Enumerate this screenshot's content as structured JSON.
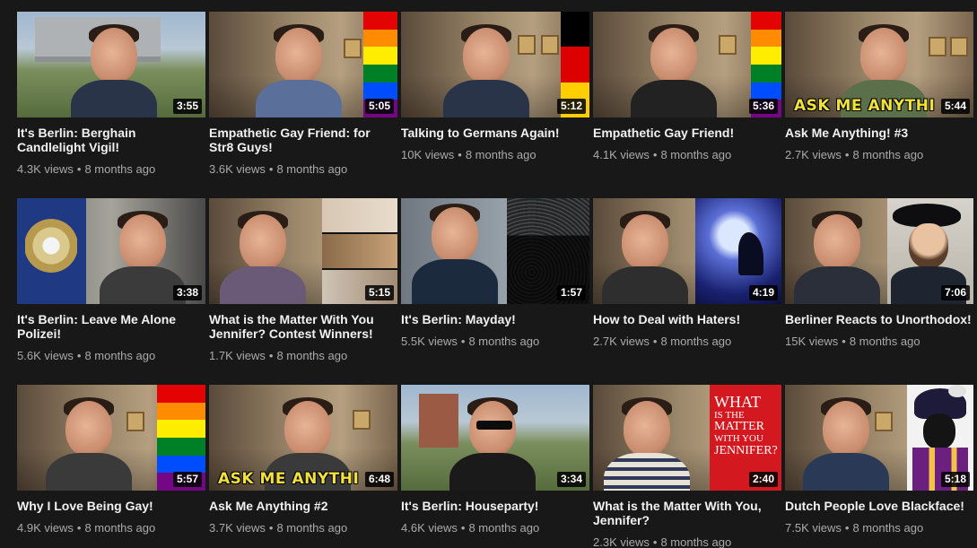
{
  "videos": [
    {
      "title": "It's Berlin: Berghain Candlelight Vigil!",
      "duration": "3:55",
      "views": "4.3K views",
      "age": "8 months ago"
    },
    {
      "title": "Empathetic Gay Friend: for Str8 Guys!",
      "duration": "5:05",
      "views": "3.6K views",
      "age": "8 months ago"
    },
    {
      "title": "Talking to Germans Again!",
      "duration": "5:12",
      "views": "10K views",
      "age": "8 months ago"
    },
    {
      "title": "Empathetic Gay Friend!",
      "duration": "5:36",
      "views": "4.1K views",
      "age": "8 months ago"
    },
    {
      "title": "Ask Me Anything! #3",
      "duration": "5:44",
      "views": "2.7K views",
      "age": "8 months ago",
      "overlay": "ASK ME ANYTHI"
    },
    {
      "title": "It's Berlin: Leave Me Alone Polizei!",
      "duration": "3:38",
      "views": "5.6K views",
      "age": "8 months ago"
    },
    {
      "title": "What is the Matter With You Jennifer? Contest Winners!",
      "duration": "5:15",
      "views": "1.7K views",
      "age": "8 months ago"
    },
    {
      "title": "It's Berlin: Mayday!",
      "duration": "1:57",
      "views": "5.5K views",
      "age": "8 months ago"
    },
    {
      "title": "How to Deal with Haters!",
      "duration": "4:19",
      "views": "2.7K views",
      "age": "8 months ago"
    },
    {
      "title": "Berliner Reacts to Unorthodox!",
      "duration": "7:06",
      "views": "15K views",
      "age": "8 months ago"
    },
    {
      "title": "Why I Love Being Gay!",
      "duration": "5:57",
      "views": "4.9K views",
      "age": "8 months ago"
    },
    {
      "title": "Ask Me Anything #2",
      "duration": "6:48",
      "views": "3.7K views",
      "age": "8 months ago",
      "overlay": "ASK ME ANYTHI"
    },
    {
      "title": "It's Berlin: Houseparty!",
      "duration": "3:34",
      "views": "4.6K views",
      "age": "8 months ago"
    },
    {
      "title": "What is the Matter With You, Jennifer?",
      "duration": "2:40",
      "views": "2.3K views",
      "age": "8 months ago",
      "overlay_lines": [
        "WHAT",
        "IS THE",
        "MATTER",
        "WITH YOU",
        "JENNIFER?"
      ]
    },
    {
      "title": "Dutch People Love Blackface!",
      "duration": "5:18",
      "views": "7.5K views",
      "age": "8 months ago"
    }
  ],
  "colors": {
    "background": "#181818",
    "title_text": "#f1f1f1",
    "meta_text": "#aaaaaa",
    "rainbow": [
      "#e40303",
      "#ff8c00",
      "#ffed00",
      "#008026",
      "#004dff",
      "#750787"
    ],
    "german_flag": [
      "#000000",
      "#dd0000",
      "#ffce00"
    ],
    "overlay_yellow": "#f2e13a",
    "jennifer_red": "#d4181f"
  }
}
